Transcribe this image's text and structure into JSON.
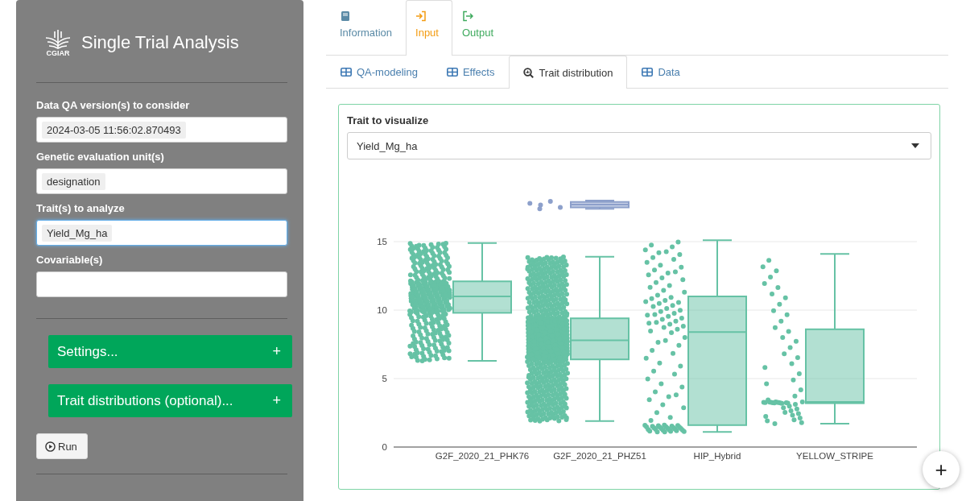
{
  "sidebar": {
    "logo_text": "CGIAR",
    "title": "Single Trial Analysis",
    "fields": [
      {
        "label": "Data QA version(s) to consider",
        "chip": "2024-03-05 11:56:02.870493",
        "focused": false
      },
      {
        "label": "Genetic evaluation unit(s)",
        "chip": "designation",
        "focused": false
      },
      {
        "label": "Trait(s) to analyze",
        "chip": "Yield_Mg_ha",
        "focused": true
      },
      {
        "label": "Covariable(s)",
        "focused": false
      }
    ],
    "collapsibles": [
      {
        "label": "Settings...",
        "expander": "+"
      },
      {
        "label": "Trait distributions (optional)...",
        "expander": "+"
      }
    ],
    "run_button": {
      "label": "Run"
    }
  },
  "main_tabs": [
    {
      "label": "Information",
      "selected": false,
      "color": "#5a8aa6"
    },
    {
      "label": "Input",
      "selected": true,
      "color": "#f39c12"
    },
    {
      "label": "Output",
      "selected": false,
      "color": "#3faa5e"
    }
  ],
  "sub_tabs": [
    {
      "label": "QA-modeling",
      "selected": false
    },
    {
      "label": "Effects",
      "selected": false
    },
    {
      "label": "Trait distribution",
      "selected": true
    },
    {
      "label": "Data",
      "selected": false
    }
  ],
  "panel": {
    "trait_select": {
      "label": "Trait to visualize",
      "value": "Yield_Mg_ha"
    },
    "box_plot": {
      "y_tick_labels": [
        "15",
        "10",
        "5",
        "0"
      ],
      "category_labels": [
        "G2F_2020_21_PHK76",
        "G2F_2020_21_PHZ51",
        "HIP_Hybrid",
        "YELLOW_STRIPE"
      ]
    }
  },
  "fab": {
    "label": "+"
  }
}
